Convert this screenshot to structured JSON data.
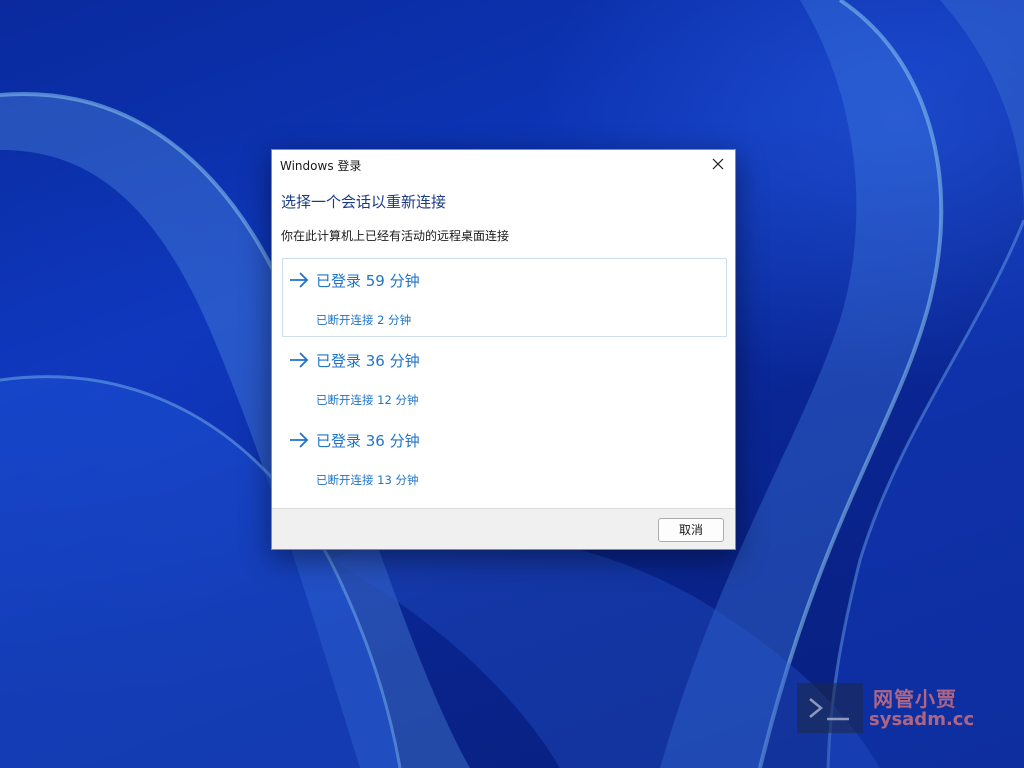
{
  "dialog": {
    "title": "Windows 登录",
    "heading": "选择一个会话以重新连接",
    "subheading": "你在此计算机上已经有活动的远程桌面连接",
    "sessions": [
      {
        "label": "已登录 59 分钟",
        "detail": "已断开连接 2 分钟",
        "selected": true
      },
      {
        "label": "已登录 36 分钟",
        "detail": "已断开连接 12 分钟",
        "selected": false
      },
      {
        "label": "已登录 36 分钟",
        "detail": "已断开连接 13 分钟",
        "selected": false
      }
    ],
    "cancel_label": "取消",
    "icons": {
      "close": "close-icon",
      "session": "arrow-right-icon"
    }
  },
  "watermark": {
    "cn": "网管小贾",
    "en": "sysadm.cc",
    "icon": "terminal-icon"
  },
  "colors": {
    "link_blue": "#1f74c8",
    "heading_blue": "#1a3a8a",
    "wallpaper_blue": "#0b2a9a"
  }
}
